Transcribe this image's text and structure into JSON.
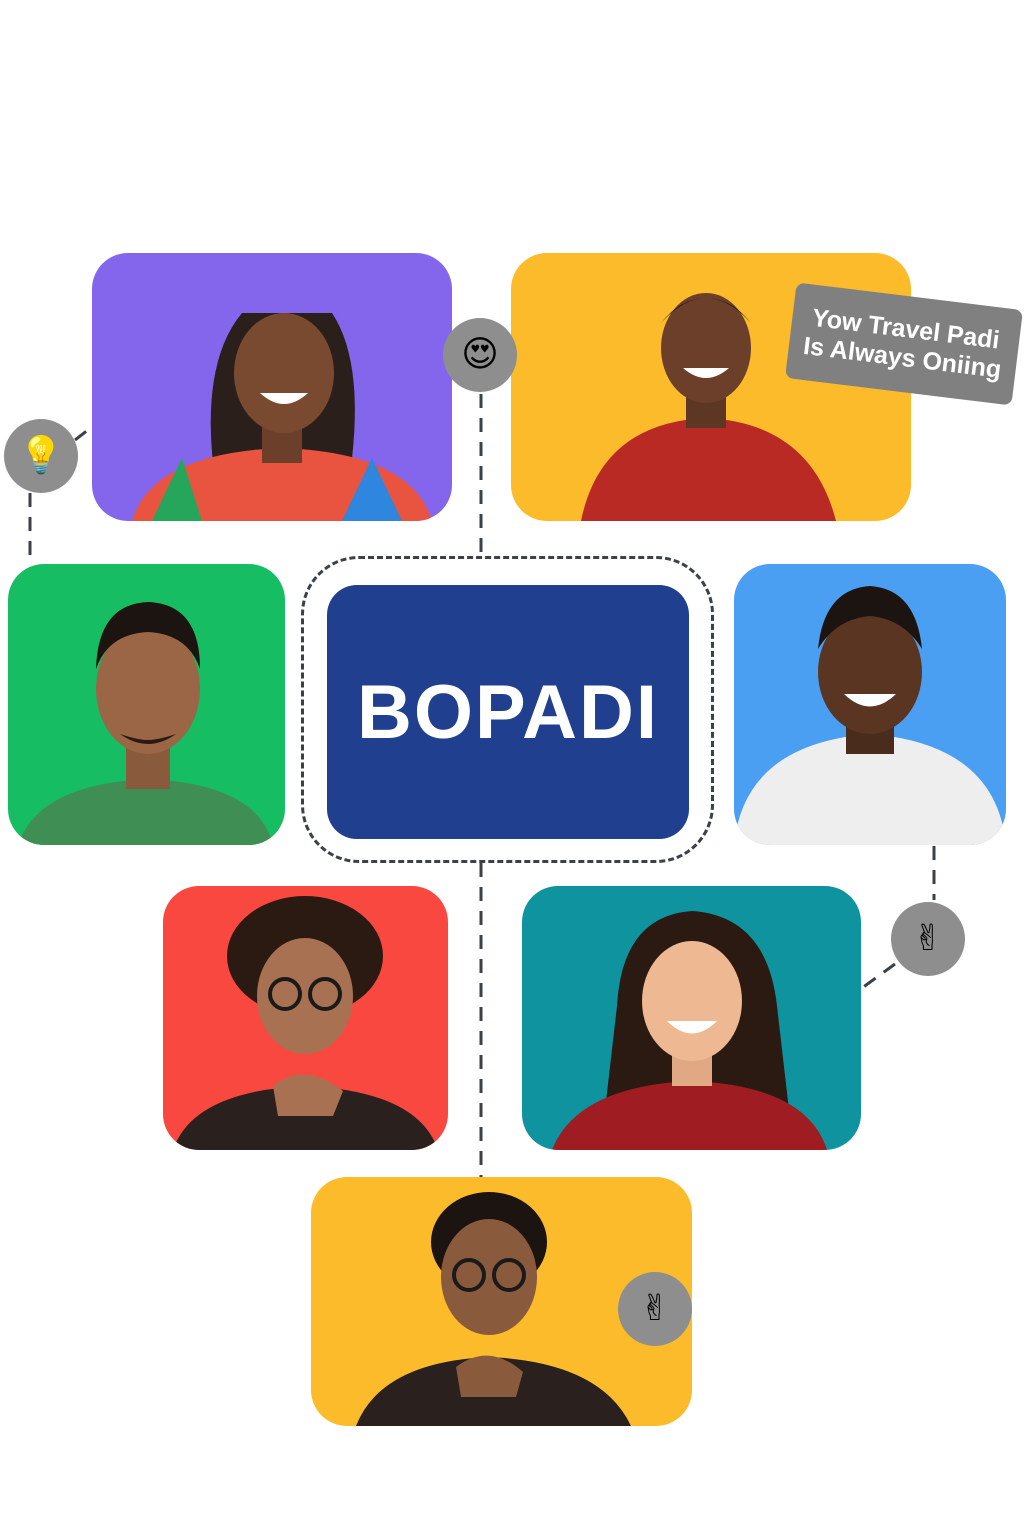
{
  "brand": {
    "name": "BOPADI",
    "color": "#213f8f"
  },
  "tag": {
    "line1": "Yow Travel Padi",
    "line2": "Is Always Oniing"
  },
  "cards": [
    {
      "id": "purple",
      "bg": "#8466ec"
    },
    {
      "id": "yellow-top",
      "bg": "#fbbb2a"
    },
    {
      "id": "green",
      "bg": "#17bd62"
    },
    {
      "id": "blue",
      "bg": "#4b9ff2"
    },
    {
      "id": "red",
      "bg": "#f8483f"
    },
    {
      "id": "teal",
      "bg": "#0e939f"
    },
    {
      "id": "yellow-bottom",
      "bg": "#fbbb2a"
    }
  ],
  "badges": [
    {
      "icon": "lightbulb-icon",
      "glyph": "💡"
    },
    {
      "icon": "heart-eyes-face-icon",
      "glyph": "😍"
    },
    {
      "icon": "peace-hand-icon",
      "glyph": "✌"
    },
    {
      "icon": "peace-hand-icon",
      "glyph": "✌"
    }
  ]
}
